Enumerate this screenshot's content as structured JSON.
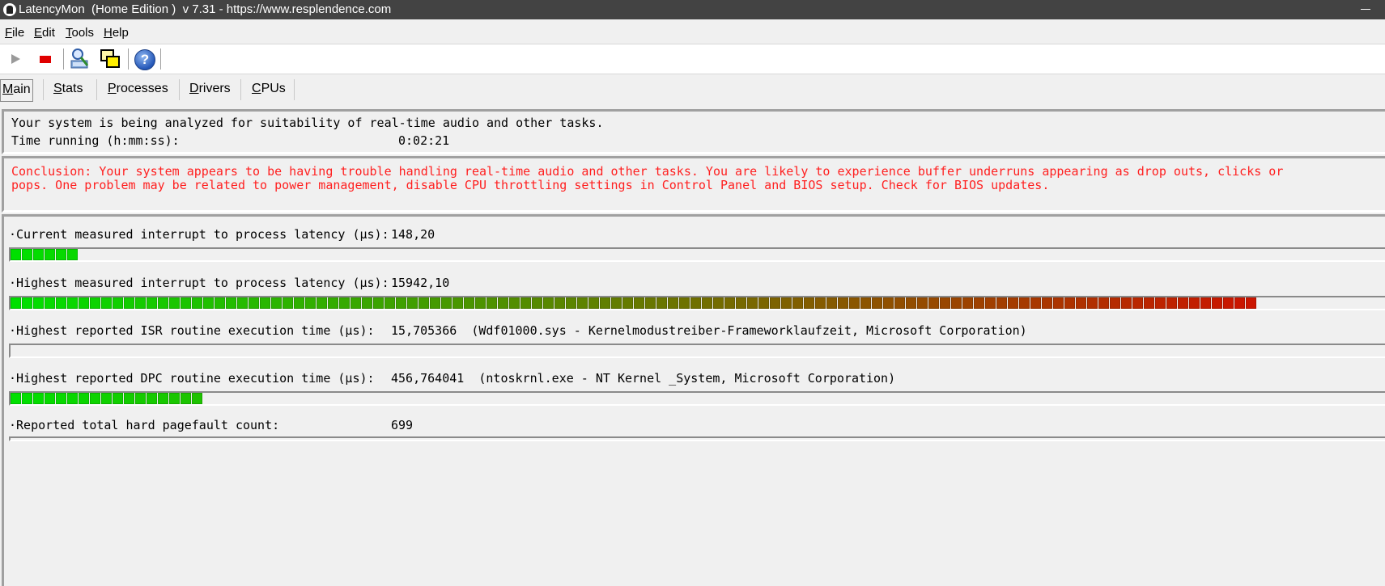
{
  "window": {
    "title": "LatencyMon  (Home Edition )  v 7.31 - https://www.resplendence.com"
  },
  "menu": [
    "File",
    "Edit",
    "Tools",
    "Help"
  ],
  "toolbar": {
    "buttons": [
      "play-icon",
      "stop-icon",
      "analyze-icon",
      "windows-icon",
      "help-icon"
    ],
    "help_glyph": "?"
  },
  "tabs": [
    "Main",
    "Stats",
    "Processes",
    "Drivers",
    "CPUs"
  ],
  "status": {
    "analysis_text": "Your system is being analyzed for suitability of real-time audio and other tasks.",
    "time_label": "Time running (h:mm:ss):",
    "time_value": "0:02:21"
  },
  "conclusion": {
    "line1": "Conclusion: Your system appears to be having trouble handling real-time audio and other tasks. You are likely to experience buffer underruns appearing as drop outs, clicks or",
    "line2": "pops. One problem may be related to power management, disable CPU throttling settings in Control Panel and BIOS setup. Check for BIOS updates.",
    "color": "#ff2020"
  },
  "metrics": [
    {
      "label": "·Current measured interrupt to process latency (µs):",
      "value": "148,20",
      "bar_fraction": 0.0477
    },
    {
      "label": "·Highest measured interrupt to process latency (µs):",
      "value": "15942,10",
      "bar_fraction": 0.9078
    },
    {
      "label": "·Highest reported ISR routine execution time (µs):",
      "value": "15,705366  (Wdf01000.sys - Kernelmodustreiber-Frameworklaufzeit, Microsoft Corporation)",
      "bar_fraction": 0
    },
    {
      "label": "·Highest reported DPC routine execution time (µs):",
      "value": "456,764041  (ntoskrnl.exe - NT Kernel _System, Microsoft Corporation)",
      "bar_fraction": 0.1405
    },
    {
      "label": "·Reported total hard pagefault count:",
      "value": "699",
      "bar_fraction": 0
    }
  ],
  "colors": {
    "bar_green": "#00e000",
    "bar_red": "#e00000"
  }
}
